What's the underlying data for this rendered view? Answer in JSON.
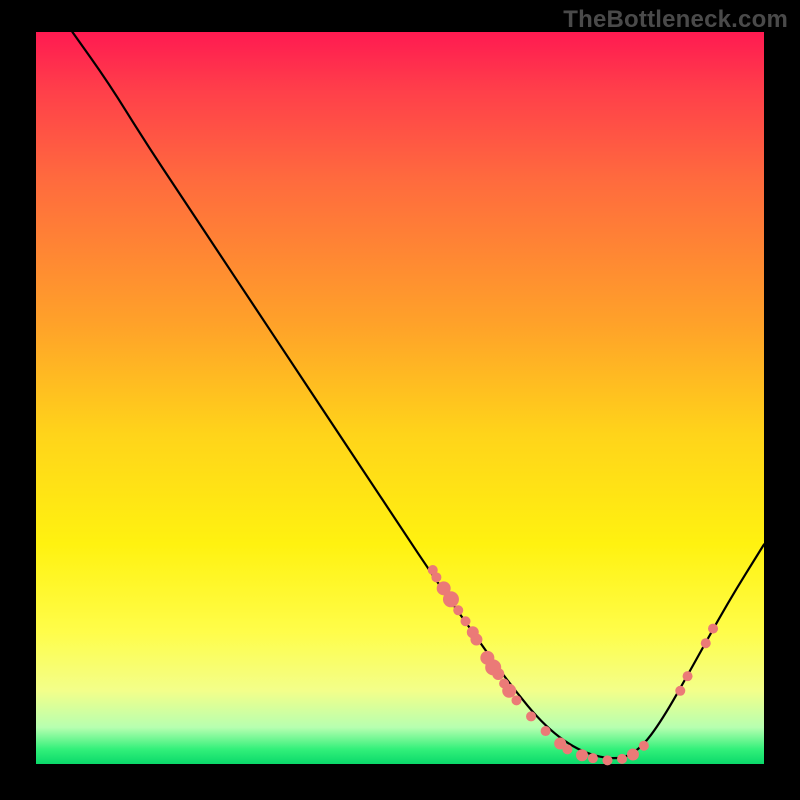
{
  "watermark": "TheBottleneck.com",
  "chart_data": {
    "type": "line",
    "title": "",
    "xlabel": "",
    "ylabel": "",
    "xlim": [
      0,
      100
    ],
    "ylim": [
      0,
      100
    ],
    "grid": false,
    "legend": false,
    "series": [
      {
        "name": "bottleneck-curve",
        "color": "#000000",
        "x": [
          5,
          10,
          15,
          20,
          25,
          30,
          35,
          40,
          45,
          50,
          55,
          60,
          65,
          70,
          75,
          80,
          83,
          86,
          90,
          95,
          100
        ],
        "y": [
          100,
          93,
          85,
          77.5,
          70,
          62.5,
          55,
          47.5,
          40,
          32.5,
          25,
          18,
          11,
          5,
          1.5,
          0.5,
          2,
          6,
          13,
          22,
          30
        ]
      }
    ],
    "marker_points": {
      "name": "highlighted-points",
      "color": "#eb7a77",
      "radius_small": 5,
      "radius_large": 8,
      "points": [
        {
          "x": 54.5,
          "y": 26.5,
          "r": 5
        },
        {
          "x": 55.0,
          "y": 25.5,
          "r": 5
        },
        {
          "x": 56.0,
          "y": 24.0,
          "r": 7
        },
        {
          "x": 57.0,
          "y": 22.5,
          "r": 8
        },
        {
          "x": 58.0,
          "y": 21.0,
          "r": 5
        },
        {
          "x": 59.0,
          "y": 19.5,
          "r": 5
        },
        {
          "x": 60.0,
          "y": 18.0,
          "r": 6
        },
        {
          "x": 60.5,
          "y": 17.0,
          "r": 6
        },
        {
          "x": 62.0,
          "y": 14.5,
          "r": 7
        },
        {
          "x": 62.8,
          "y": 13.2,
          "r": 8
        },
        {
          "x": 63.5,
          "y": 12.3,
          "r": 6
        },
        {
          "x": 64.3,
          "y": 11.0,
          "r": 5
        },
        {
          "x": 65.0,
          "y": 10.0,
          "r": 7
        },
        {
          "x": 66.0,
          "y": 8.7,
          "r": 5
        },
        {
          "x": 68.0,
          "y": 6.5,
          "r": 5
        },
        {
          "x": 70.0,
          "y": 4.5,
          "r": 5
        },
        {
          "x": 72.0,
          "y": 2.8,
          "r": 6
        },
        {
          "x": 73.0,
          "y": 2.0,
          "r": 5
        },
        {
          "x": 75.0,
          "y": 1.2,
          "r": 6
        },
        {
          "x": 76.5,
          "y": 0.8,
          "r": 5
        },
        {
          "x": 78.5,
          "y": 0.5,
          "r": 5
        },
        {
          "x": 80.5,
          "y": 0.7,
          "r": 5
        },
        {
          "x": 82.0,
          "y": 1.3,
          "r": 6
        },
        {
          "x": 83.5,
          "y": 2.5,
          "r": 5
        },
        {
          "x": 88.5,
          "y": 10.0,
          "r": 5
        },
        {
          "x": 89.5,
          "y": 12.0,
          "r": 5
        },
        {
          "x": 92.0,
          "y": 16.5,
          "r": 5
        },
        {
          "x": 93.0,
          "y": 18.5,
          "r": 5
        }
      ]
    }
  }
}
